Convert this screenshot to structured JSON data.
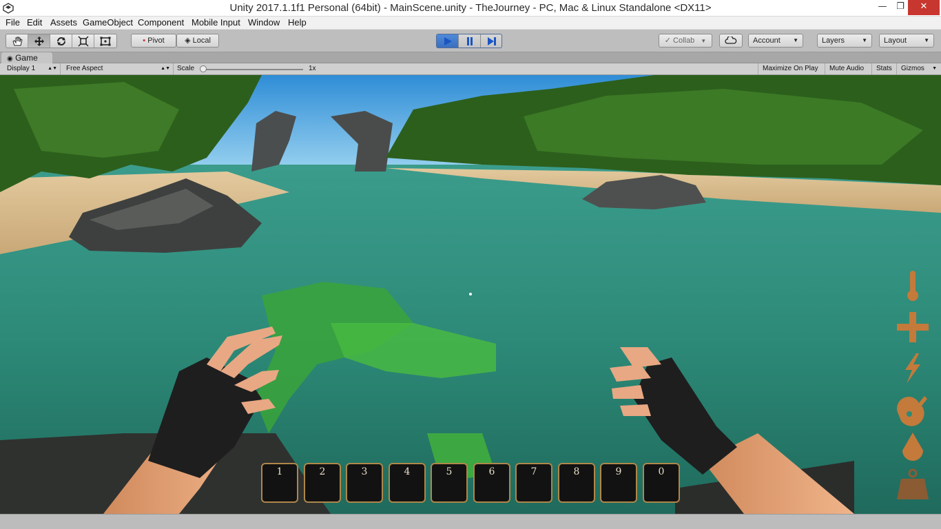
{
  "window": {
    "title": "Unity 2017.1.1f1 Personal (64bit) - MainScene.unity - TheJourney - PC, Mac & Linux Standalone <DX11>",
    "minimize_glyph": "—",
    "maximize_glyph": "❐",
    "close_glyph": "✕"
  },
  "menu": {
    "items": [
      "File",
      "Edit",
      "Assets",
      "GameObject",
      "Component",
      "Mobile Input",
      "Window",
      "Help"
    ]
  },
  "toolbar": {
    "tools": [
      "hand-tool-icon",
      "move-tool-icon",
      "rotate-tool-icon",
      "scale-tool-icon",
      "rect-tool-icon"
    ],
    "active_tool": "move-tool-icon",
    "pivot_label": "Pivot",
    "local_label": "Local",
    "collab_label": "Collab",
    "account_label": "Account",
    "layers_label": "Layers",
    "layout_label": "Layout",
    "play_state": "playing"
  },
  "game_view": {
    "tab_label": "Game",
    "display_label": "Display 1",
    "aspect_label": "Free Aspect",
    "scale_label": "Scale",
    "scale_value": "1x",
    "maximize_on_play_label": "Maximize On Play",
    "mute_audio_label": "Mute Audio",
    "stats_label": "Stats",
    "gizmos_label": "Gizmos"
  },
  "hud": {
    "hotbar_slots": [
      "1",
      "2",
      "3",
      "4",
      "5",
      "6",
      "7",
      "8",
      "9",
      "0"
    ],
    "stat_icons": [
      "temperature-icon",
      "health-icon",
      "energy-icon",
      "hunger-icon",
      "thirst-icon",
      "weight-icon"
    ],
    "stat_color": "#c47a3a"
  },
  "colors": {
    "sky": "#5ab3e6",
    "water": "#2f8f7f",
    "sand": "#d8b98a",
    "foliage": "#2f6a1f",
    "hotbar_border": "#b08749"
  }
}
